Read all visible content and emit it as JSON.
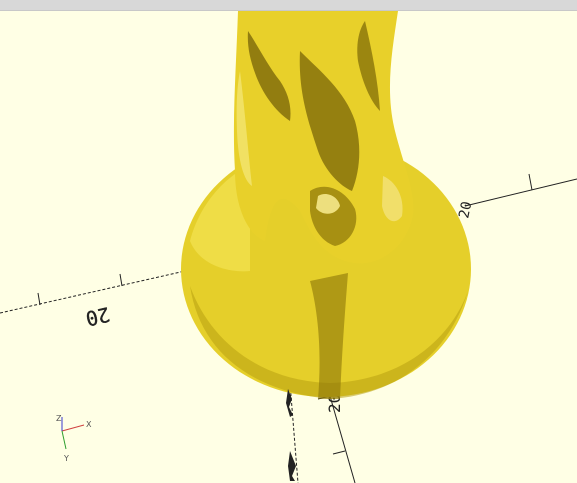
{
  "window": {
    "title": ""
  },
  "viewport": {
    "background_color": "#ffffe5",
    "model_color": "#e8d02a",
    "axis_labels": {
      "x": "X",
      "y": "Y",
      "z": "Z"
    },
    "ruler_labels": [
      {
        "id": "ruler-left",
        "text": "20"
      },
      {
        "id": "ruler-right",
        "text": "20"
      },
      {
        "id": "ruler-bottom",
        "text": "20"
      }
    ]
  }
}
